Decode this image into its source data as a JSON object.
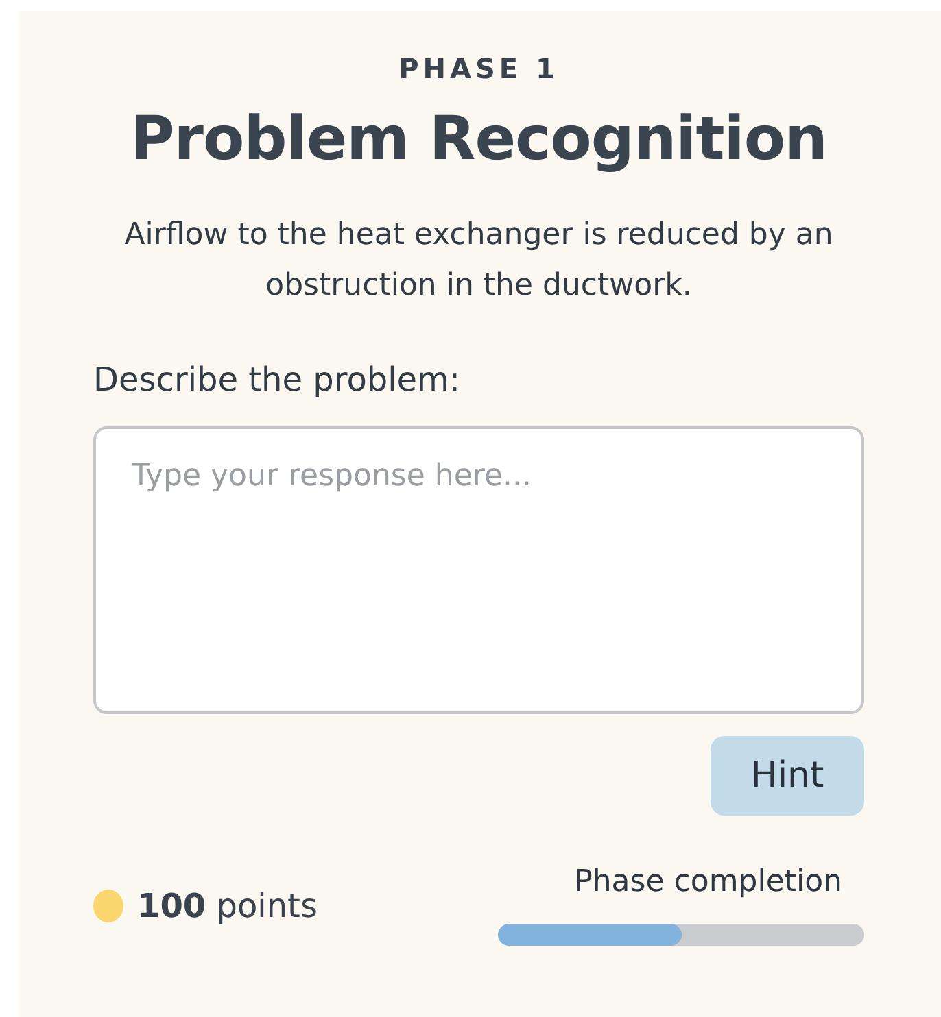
{
  "phase_label": "PHASE 1",
  "title": "Problem Recognition",
  "description": "Airflow to the heat exchanger is reduced by an obstruction in the ductwork.",
  "prompt_label": "Describe the problem:",
  "response": {
    "placeholder": "Type your response here..."
  },
  "hint_button": "Hint",
  "points": "**100** points",
  "progress": {
    "label": "Phase completion",
    "level": 0.5
  }
}
